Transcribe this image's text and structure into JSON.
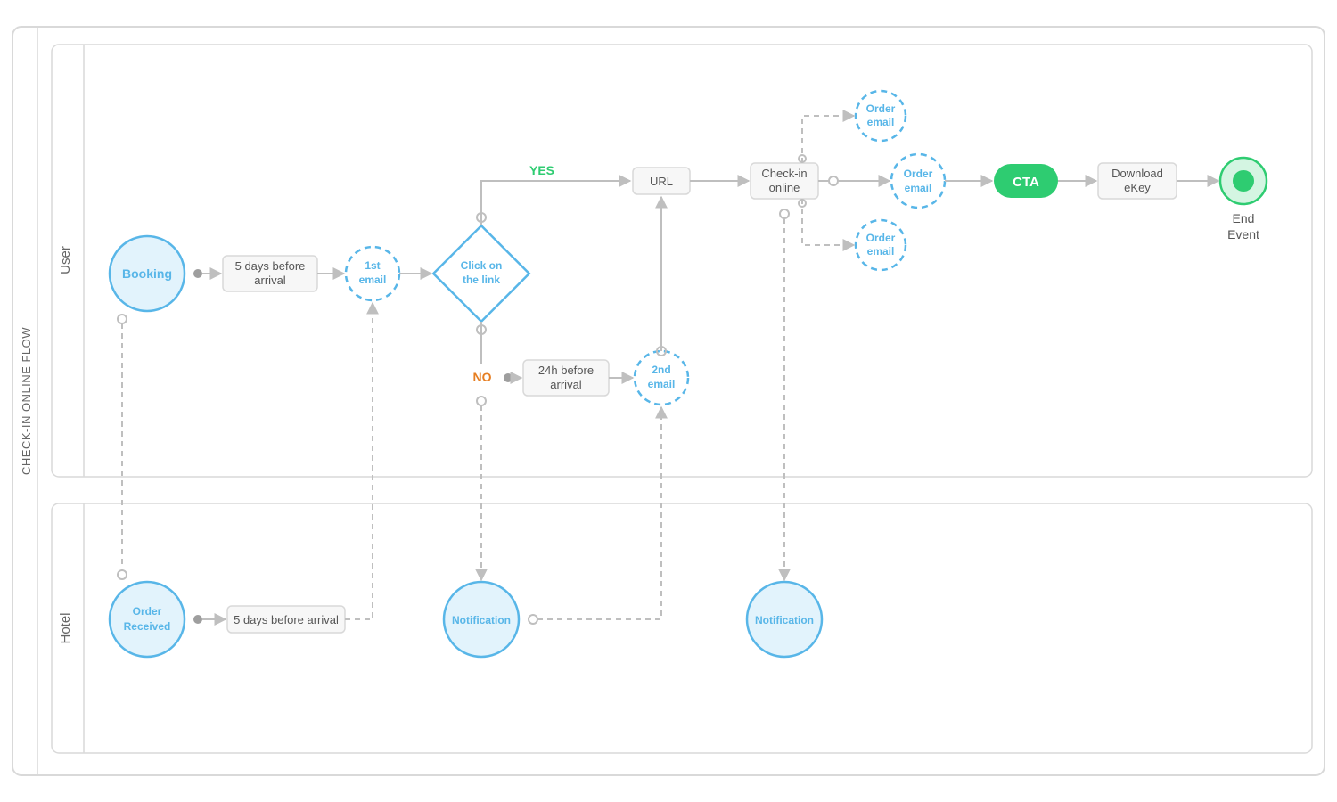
{
  "pool_title": "CHECK-IN ONLINE FLOW",
  "lanes": {
    "user": "User",
    "hotel": "Hotel"
  },
  "nodes": {
    "booking": "Booking",
    "five_days_before": "5 days before\narrival",
    "first_email": "1st\nemail",
    "click_link": "Click on\nthe link",
    "yes": "YES",
    "no": "NO",
    "twenty_four_h": "24h before\narrival",
    "second_email": "2nd\nemail",
    "url": "URL",
    "checkin_online": "Check-in\nonline",
    "order_email_top": "Order\nemail",
    "order_email_mid": "Order\nemail",
    "order_email_bottom": "Order\nemail",
    "cta": "CTA",
    "download_ekey": "Download\neKey",
    "end_event": "End\nEvent",
    "order_received": "Order\nReceived",
    "hotel_five_days": "5 days before arrival",
    "notification1": "Notification",
    "notification2": "Notification"
  },
  "colors": {
    "cyan": "#58b6e8",
    "cyanFill": "#e2f3fc",
    "green": "#2ecc71",
    "greenLight": "#a8ebc4",
    "orange": "#e67e22",
    "grey": "#bfbfbf",
    "greyDark": "#9e9e9e",
    "boxBorder": "#d9d9d9",
    "boxFill": "#f7f7f7"
  }
}
